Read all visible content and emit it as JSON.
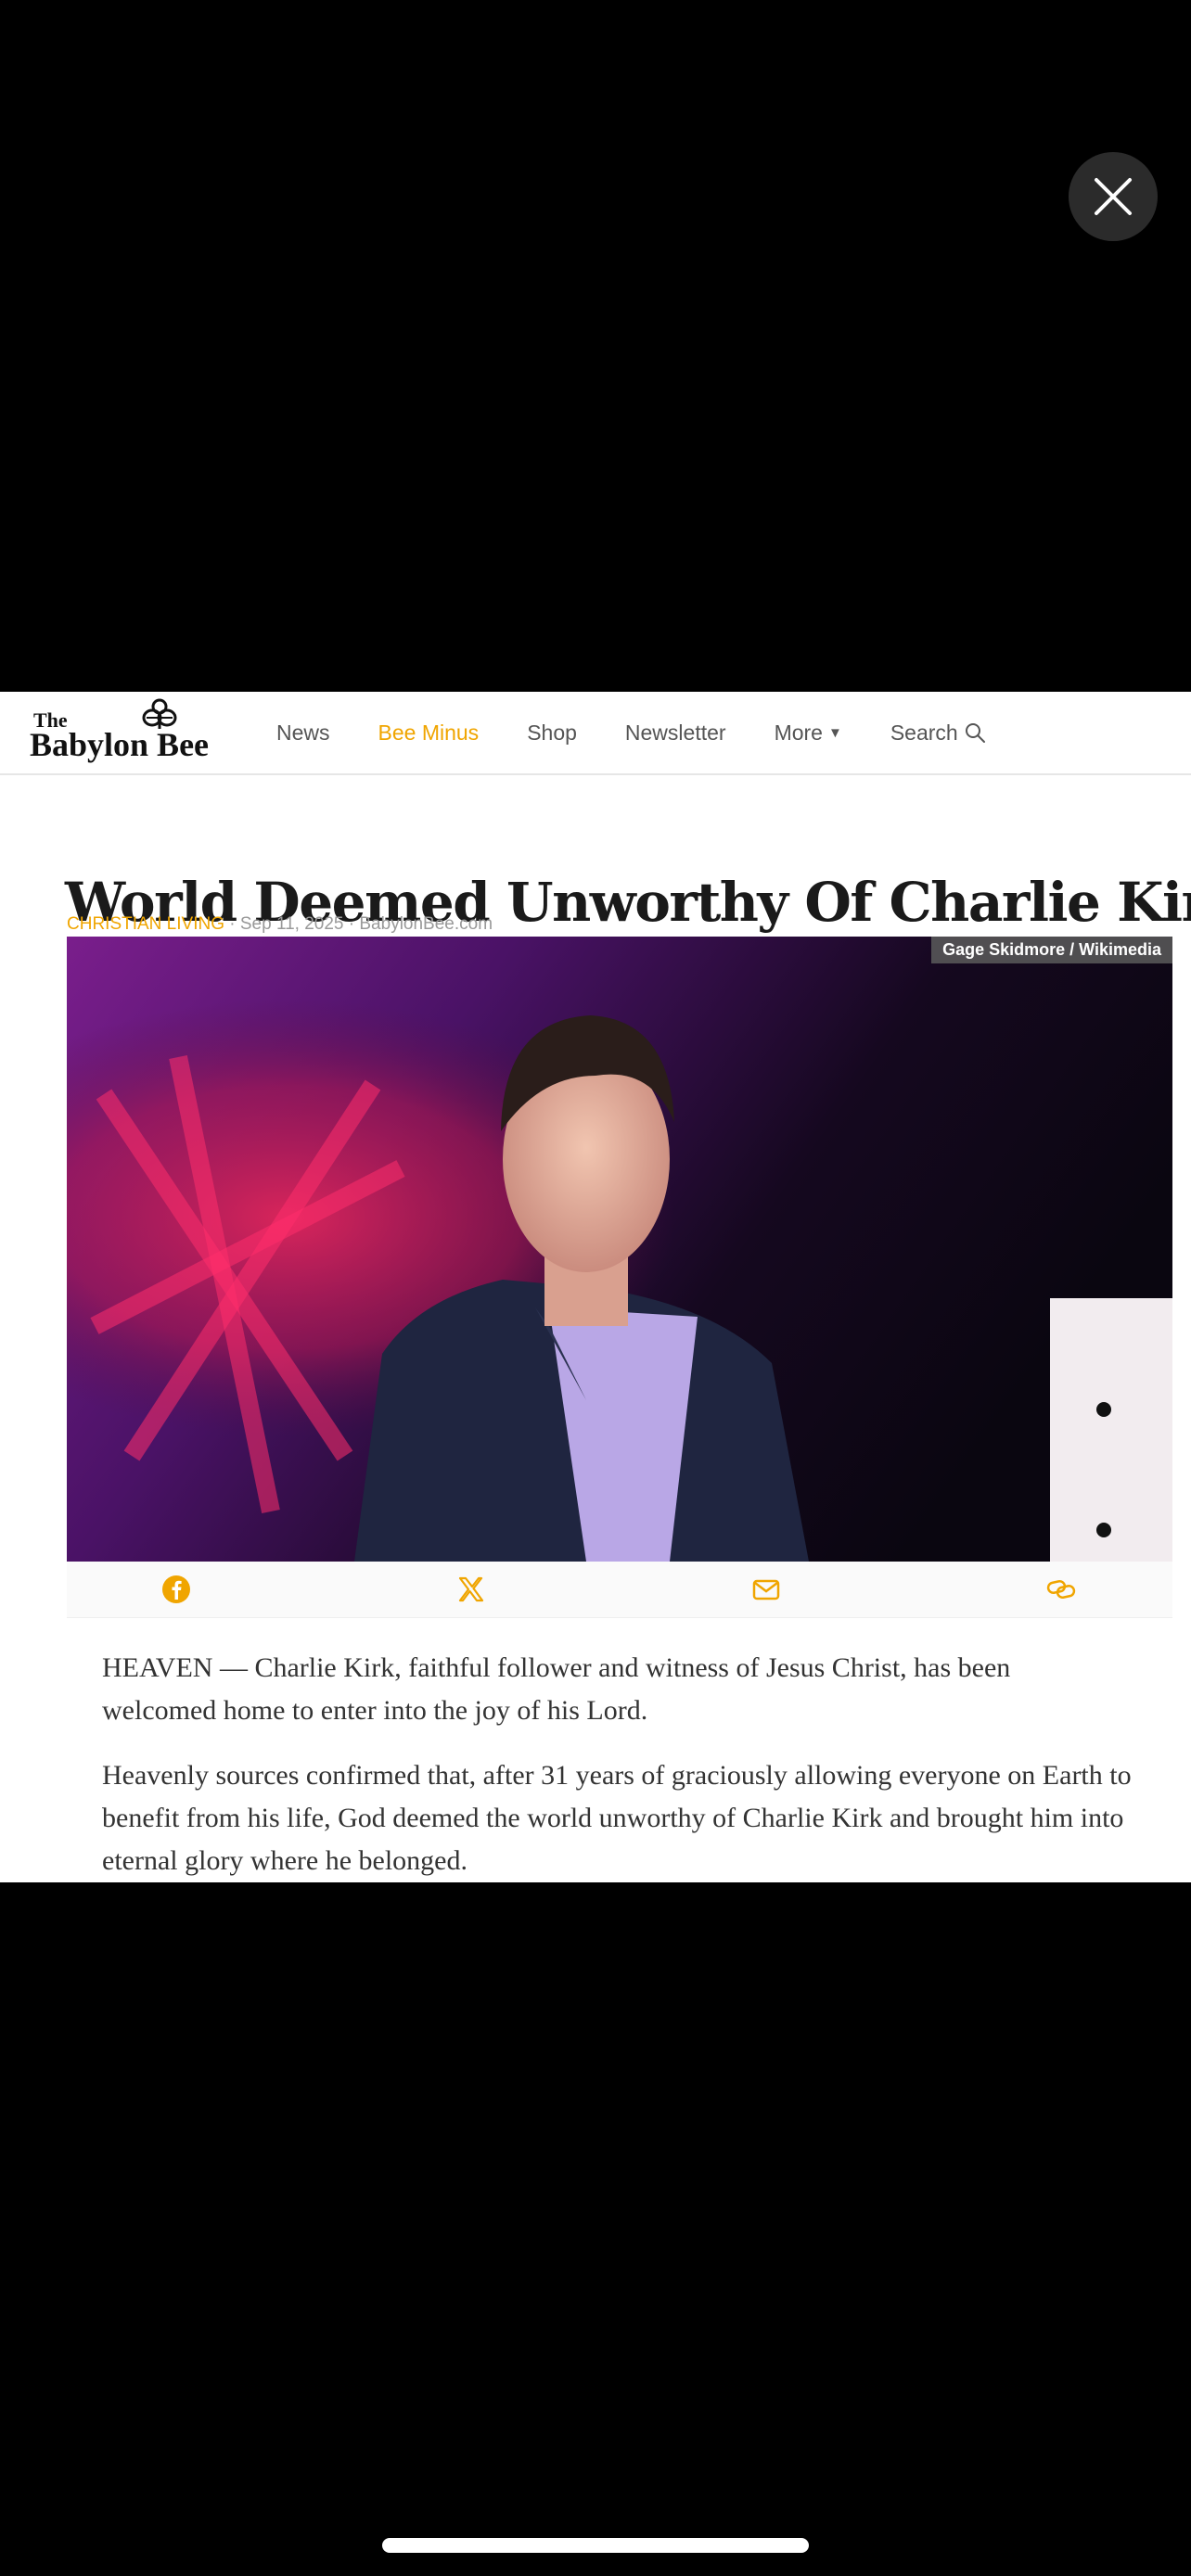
{
  "viewer": {
    "close_icon": "close-icon"
  },
  "site": {
    "logo_the": "The",
    "logo_name": "Babylon Bee",
    "nav": [
      {
        "label": "News"
      },
      {
        "label": "Bee Minus"
      },
      {
        "label": "Shop"
      },
      {
        "label": "Newsletter"
      },
      {
        "label": "More"
      },
      {
        "label": "Search"
      }
    ]
  },
  "article": {
    "title": "World Deemed Unworthy Of Charlie Kirk",
    "category": "CHRISTIAN LIVING",
    "meta_rest": " · Sep 11, 2025 · BabylonBee.com",
    "photo_credit": "Gage Skidmore / Wikimedia",
    "paragraphs": [
      "HEAVEN — Charlie Kirk, faithful follower and witness of Jesus Christ, has been welcomed home to enter into the joy of his Lord.",
      "Heavenly sources confirmed that, after 31 years of graciously allowing everyone on Earth to benefit from his life, God deemed the world unworthy of Charlie Kirk and brought him into eternal glory where he belonged."
    ]
  },
  "share": {
    "icons": [
      "facebook-icon",
      "x-icon",
      "email-icon",
      "link-icon"
    ]
  },
  "colors": {
    "accent": "#f0a500",
    "background": "#000000",
    "page": "#ffffff"
  }
}
